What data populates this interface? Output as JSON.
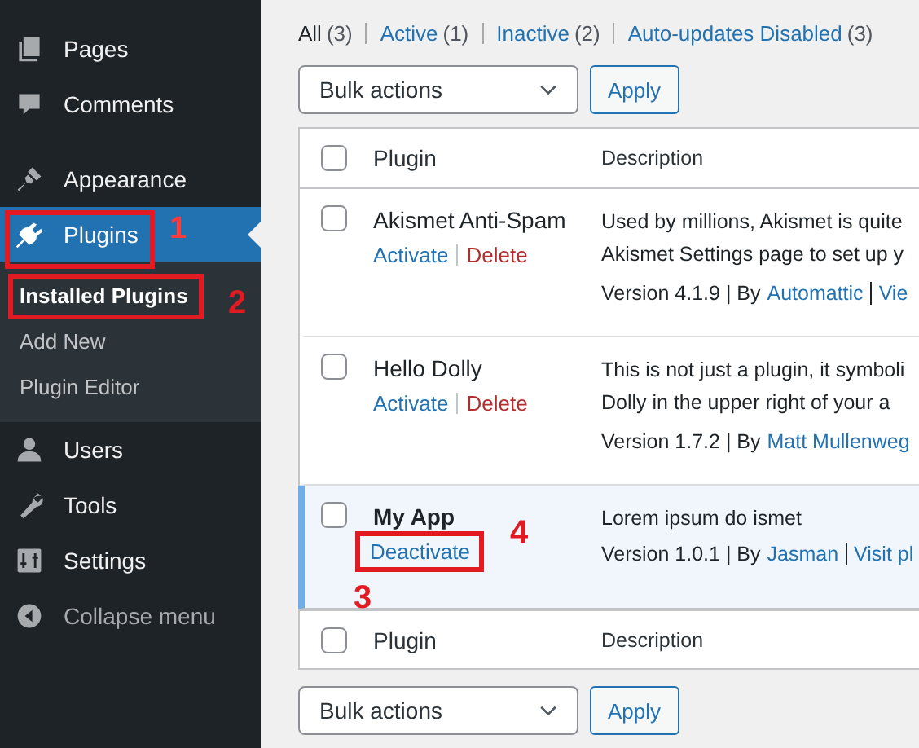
{
  "sidebar": {
    "items": [
      {
        "label": "Pages",
        "kind": "pages",
        "current": false
      },
      {
        "label": "Comments",
        "kind": "comments",
        "current": false
      },
      {
        "label": "Appearance",
        "kind": "appearance",
        "current": false
      },
      {
        "label": "Plugins",
        "kind": "plugins",
        "current": true,
        "annotation": "1",
        "submenu": [
          {
            "label": "Installed Plugins",
            "selected": true,
            "annotation": "2"
          },
          {
            "label": "Add New",
            "selected": false
          },
          {
            "label": "Plugin Editor",
            "selected": false
          }
        ]
      },
      {
        "label": "Users",
        "kind": "users",
        "current": false
      },
      {
        "label": "Tools",
        "kind": "tools",
        "current": false
      },
      {
        "label": "Settings",
        "kind": "settings",
        "current": false
      },
      {
        "label": "Collapse menu",
        "kind": "collapse",
        "current": false
      }
    ]
  },
  "filters": [
    {
      "label": "All",
      "count": "(3)",
      "selected": true
    },
    {
      "label": "Active",
      "count": "(1)",
      "selected": false
    },
    {
      "label": "Inactive",
      "count": "(2)",
      "selected": false
    },
    {
      "label": "Auto-updates Disabled",
      "count": "(3)",
      "selected": false
    }
  ],
  "bulk_top": {
    "value": "Bulk actions",
    "button": "Apply"
  },
  "table": {
    "columns": [
      "Plugin",
      "Description"
    ],
    "header_checked": false,
    "footer_checked": false,
    "rows": [
      {
        "name": "Akismet Anti-Spam",
        "active": false,
        "checked": false,
        "actions": [
          {
            "label": "Activate",
            "kind": "activate"
          },
          {
            "label": "Delete",
            "kind": "delete"
          }
        ],
        "description": [
          "Used by millions, Akismet is quite",
          "Akismet Settings page to set up y"
        ],
        "version": "Version 4.1.9 | By",
        "author": "Automattic",
        "more": "Vie"
      },
      {
        "name": "Hello Dolly",
        "active": false,
        "checked": false,
        "actions": [
          {
            "label": "Activate",
            "kind": "activate"
          },
          {
            "label": "Delete",
            "kind": "delete"
          }
        ],
        "description": [
          "This is not just a plugin, it symboli",
          "Dolly in the upper right of your a"
        ],
        "version": "Version 1.7.2 | By",
        "author": "Matt Mullenweg"
      },
      {
        "name": "My App",
        "active": true,
        "checked": false,
        "actions": [
          {
            "label": "Deactivate",
            "kind": "deactivate",
            "annotation": "4",
            "annotation_below": "3"
          }
        ],
        "description": [
          "Lorem ipsum do ismet"
        ],
        "version": "Version 1.0.1 | By",
        "author": "Jasman",
        "more": "Visit pl"
      }
    ],
    "footer_columns": [
      "Plugin",
      "Description"
    ]
  },
  "bulk_bottom": {
    "value": "Bulk actions",
    "button": "Apply"
  }
}
